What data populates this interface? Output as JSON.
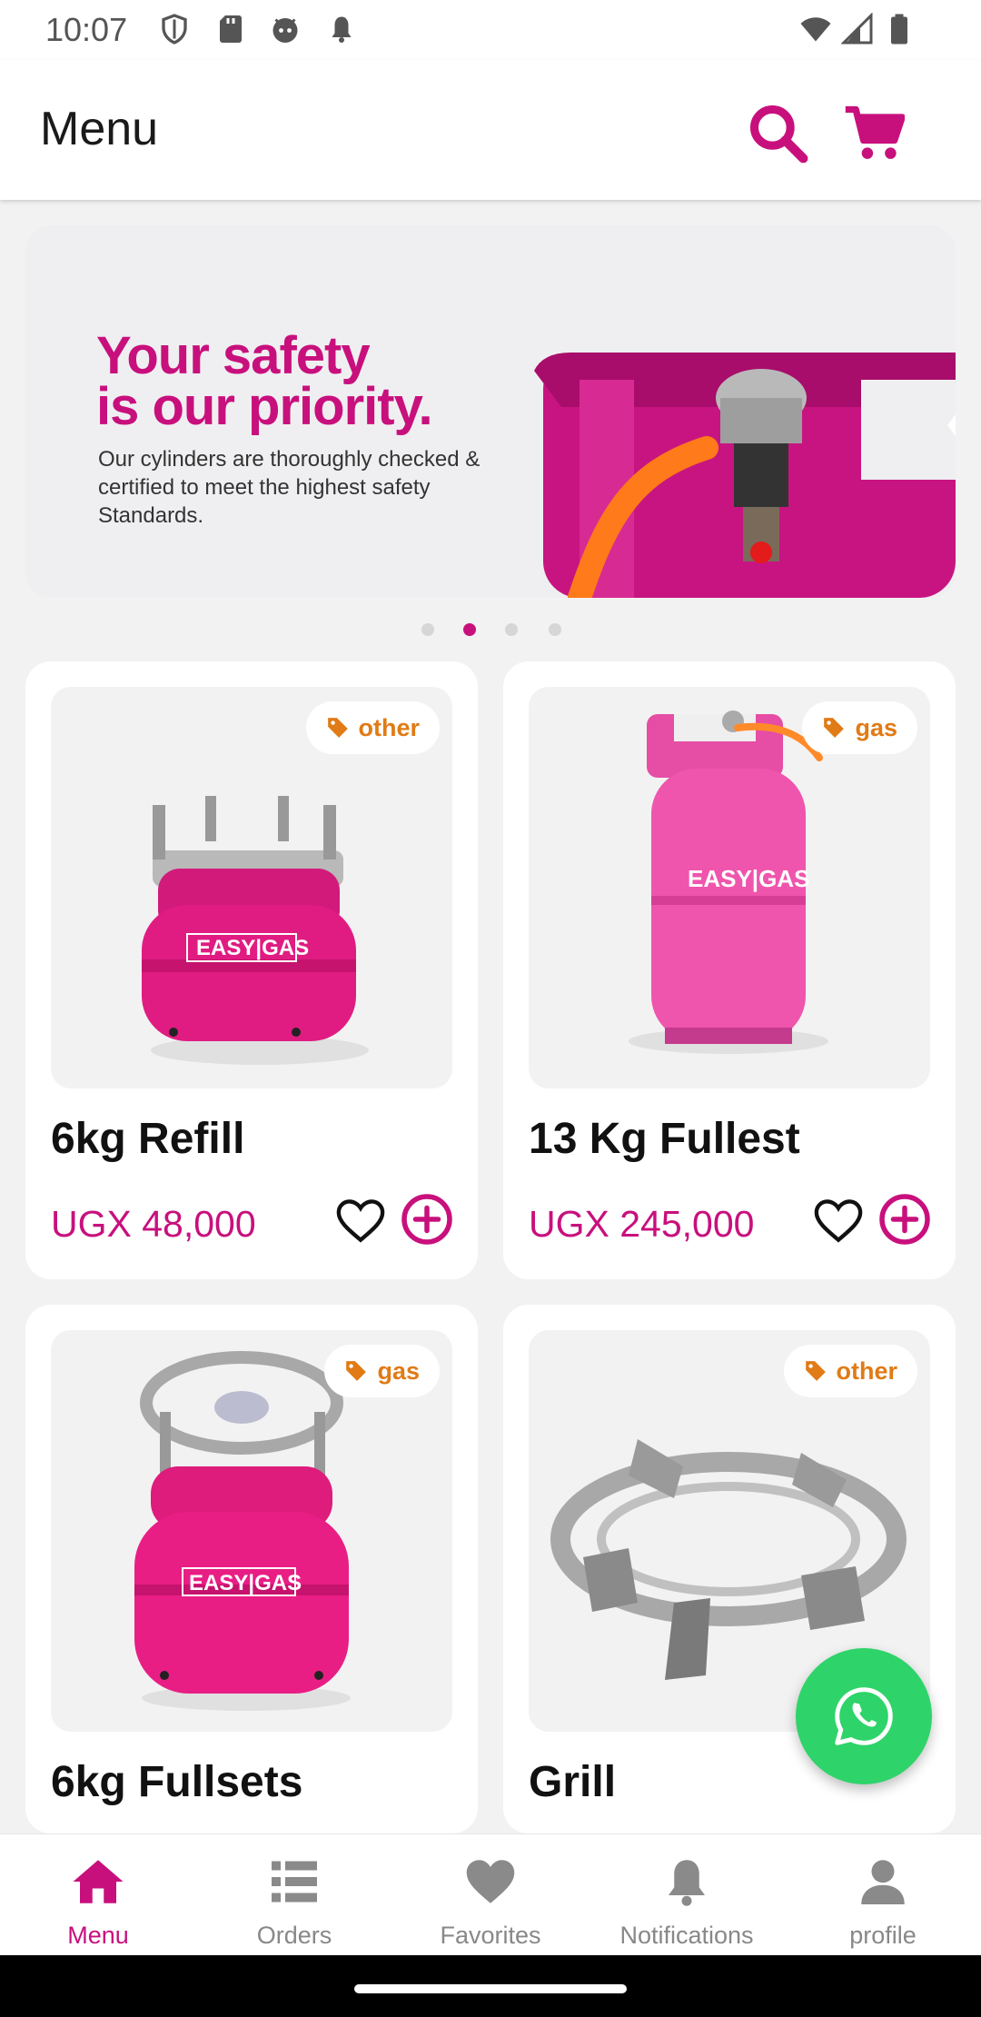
{
  "status_bar": {
    "time": "10:07",
    "icons_left": [
      "shield-icon",
      "sd-card-icon",
      "android-head-icon",
      "bell-icon"
    ],
    "icons_right": [
      "wifi-icon",
      "cell-signal-icon",
      "battery-icon"
    ]
  },
  "header": {
    "title": "Menu",
    "search_icon": "search-icon",
    "cart_icon": "cart-icon"
  },
  "banner": {
    "headline_line1": "Your safety",
    "headline_line2": "is our priority.",
    "body": "Our cylinders are thoroughly checked & certified to meet the highest safety Standards.",
    "pagination": {
      "count": 4,
      "active_index": 1
    }
  },
  "products": [
    {
      "name": "6kg Refill",
      "tag": "other",
      "price": "UGX 48,000",
      "image": "6kg-cylinder-with-burner"
    },
    {
      "name": "13 Kg Fullest",
      "tag": "gas",
      "price": "UGX 245,000",
      "image": "13kg-cylinder"
    },
    {
      "name": "6kg Fullsets",
      "tag": "gas",
      "price": "",
      "image": "6kg-fullset-cylinder"
    },
    {
      "name": "Grill",
      "tag": "other",
      "price": "",
      "image": "grill-ring"
    }
  ],
  "fab": {
    "icon": "whatsapp-icon"
  },
  "bottom_nav": {
    "items": [
      {
        "label": "Menu",
        "icon": "home-icon",
        "active": true
      },
      {
        "label": "Orders",
        "icon": "list-icon",
        "active": false
      },
      {
        "label": "Favorites",
        "icon": "heart-icon",
        "active": false
      },
      {
        "label": "Notifications",
        "icon": "bell-icon",
        "active": false
      },
      {
        "label": "profile",
        "icon": "person-icon",
        "active": false
      }
    ]
  },
  "colors": {
    "brand": "#c8107d",
    "tag": "#e07b16",
    "whatsapp": "#2ed469",
    "inactive": "#888888"
  }
}
